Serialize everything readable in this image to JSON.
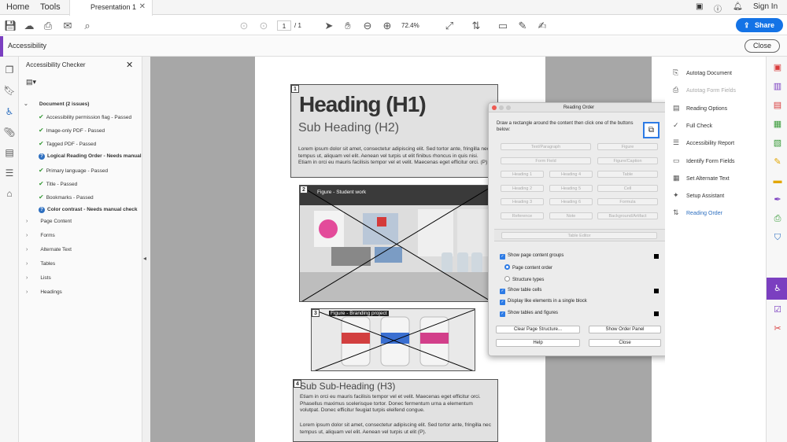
{
  "nav": {
    "home": "Home",
    "tools": "Tools",
    "doc_tab": "Presentation 1",
    "sign_in": "Sign In",
    "share": "Share"
  },
  "toolbar": {
    "page_current": "1",
    "page_total": "/ 1",
    "zoom": "72.4%"
  },
  "acc_bar": {
    "title": "Accessibility",
    "close": "Close"
  },
  "checker": {
    "title": "Accessibility Checker",
    "document": "Document (2 issues)",
    "items": [
      {
        "label": "Accessibility permission flag - Passed",
        "status": "pass"
      },
      {
        "label": "Image-only PDF - Passed",
        "status": "pass"
      },
      {
        "label": "Tagged PDF - Passed",
        "status": "pass"
      },
      {
        "label": "Logical Reading Order - Needs manual",
        "status": "manual"
      },
      {
        "label": "Primary language - Passed",
        "status": "pass"
      },
      {
        "label": "Title - Passed",
        "status": "pass"
      },
      {
        "label": "Bookmarks - Passed",
        "status": "pass"
      },
      {
        "label": "Color contrast - Needs manual check",
        "status": "manual"
      }
    ],
    "sections": [
      "Page Content",
      "Forms",
      "Alternate Text",
      "Tables",
      "Lists",
      "Headings"
    ]
  },
  "page": {
    "n1": "1",
    "n2": "2",
    "n3": "3",
    "n4": "4",
    "h1": "Heading (H1)",
    "h2": "Sub Heading (H2)",
    "p1": "Lorem ipsum dolor sit amet, consectetur adipiscing elit. Sed tortor ante, fringilla nec tempus ut, aliquam vel elit. Aenean vel turpis ut elit finibus rhoncus in quis nisi. Etiam in orci eu mauris facilisis tempor vel et velit. Maecenas eget efficitur orci. (P)",
    "fig1": "Figure - Student work",
    "fig2": "Figure - Branding project",
    "h3": "Sub Sub-Heading (H3)",
    "p2": "Etiam in orci eu mauris facilisis tempor vel et velit. Maecenas eget efficitur orci. Phasellus maximus scelerisque tortor. Donec fermentum urna a elementum volutpat. Donec efficitur feugiat turpis eleifend congue.",
    "p3": "Lorem ipsum dolor sit amet, consectetur adipiscing elit. Sed tortor ante, fringilla nec tempus ut, aliquam vel elit. Aenean vel turpis ut elit (P)."
  },
  "dialog": {
    "title": "Reading Order",
    "instructions": "Draw a rectangle around the content then click one of the buttons below:",
    "buttons": [
      "Text/Paragraph",
      "Figure",
      "Form Field",
      "Figure/Caption",
      "Heading 1",
      "Heading 4",
      "Table",
      "Heading 2",
      "Heading 5",
      "Cell",
      "Heading 3",
      "Heading 6",
      "Formula",
      "Reference",
      "Note",
      "Background/Artifact"
    ],
    "table_editor": "Table Editor",
    "opt_groups": "Show page content groups",
    "opt_order": "Page content order",
    "opt_types": "Structure types",
    "opt_cells": "Show table cells",
    "opt_like": "Display like elements in a single block",
    "opt_tables": "Show tables and figures",
    "clear": "Clear Page Structure...",
    "show_panel": "Show Order Panel",
    "help": "Help",
    "close": "Close"
  },
  "tools": [
    {
      "label": "Autotag Document",
      "icon": "autotag-icon",
      "state": "normal"
    },
    {
      "label": "Autotag Form Fields",
      "icon": "form-tag-icon",
      "state": "dim"
    },
    {
      "label": "Reading Options",
      "icon": "reading-options-icon",
      "state": "normal"
    },
    {
      "label": "Full Check",
      "icon": "check-icon",
      "state": "normal"
    },
    {
      "label": "Accessibility Report",
      "icon": "report-icon",
      "state": "normal"
    },
    {
      "label": "Identify Form Fields",
      "icon": "form-icon",
      "state": "normal"
    },
    {
      "label": "Set Alternate Text",
      "icon": "alt-text-icon",
      "state": "normal"
    },
    {
      "label": "Setup Assistant",
      "icon": "wand-icon",
      "state": "normal"
    },
    {
      "label": "Reading Order",
      "icon": "reading-order-icon",
      "state": "selected"
    }
  ],
  "colors": {
    "accent": "#1473e6",
    "purple": "#7b3fc0",
    "pass": "#3a9b3a",
    "manual": "#2d6fc0"
  }
}
